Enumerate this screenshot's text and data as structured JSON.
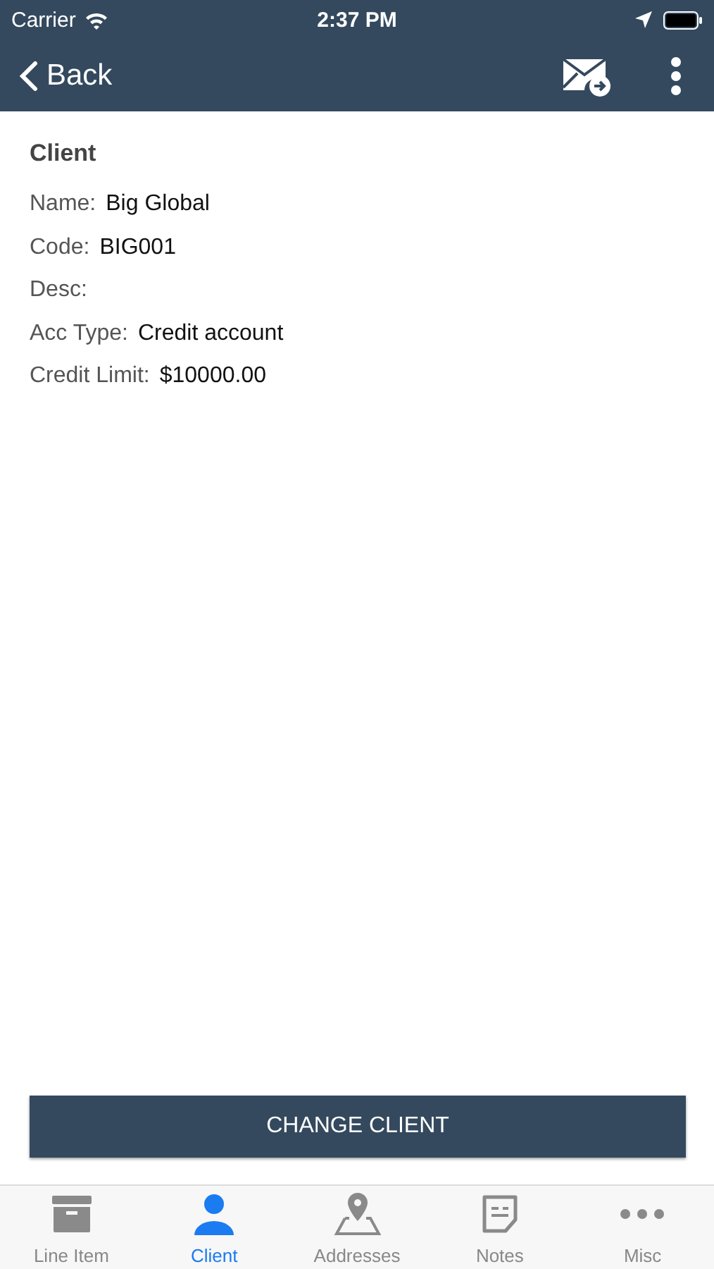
{
  "status_bar": {
    "carrier": "Carrier",
    "time": "2:37 PM"
  },
  "nav_bar": {
    "back_label": "Back"
  },
  "client": {
    "heading": "Client",
    "fields": [
      {
        "label": "Name:",
        "value": "Big Global"
      },
      {
        "label": "Code:",
        "value": "BIG001"
      },
      {
        "label": "Desc:"
      },
      {
        "label": "Acc Type:",
        "value": "Credit account"
      },
      {
        "label": "Credit Limit:",
        "value": "$10000.00"
      }
    ]
  },
  "action_button": "CHANGE CLIENT",
  "tabs": [
    {
      "label": "Line Item",
      "selected": false
    },
    {
      "label": "Client",
      "selected": true
    },
    {
      "label": "Addresses",
      "selected": false
    },
    {
      "label": "Notes",
      "selected": false
    },
    {
      "label": "Misc",
      "selected": false
    }
  ]
}
